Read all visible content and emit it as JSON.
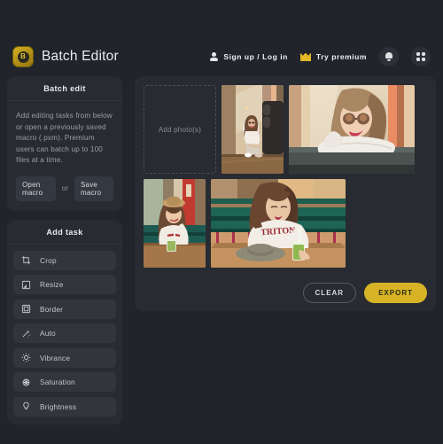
{
  "app": {
    "background": "#21242a",
    "accent": "#d6b426"
  },
  "header": {
    "logo_letter": "B",
    "title": "Batch Editor",
    "signup_label": "Sign up / Log in",
    "premium_label": "Try premium",
    "person_icon": "person-icon",
    "crown_icon": "crown-icon",
    "bell_icon": "bell-icon",
    "apps_icon": "grid-apps-icon"
  },
  "sidebar": {
    "batch_edit": {
      "title": "Batch edit",
      "description": "Add editing tasks from below or open a previously saved macro (.pxm). Premium users can batch up to 100 files at a time.",
      "open_macro_label": "Open macro",
      "or_label": "or",
      "save_macro_label": "Save macro"
    },
    "add_task": {
      "title": "Add task",
      "items": [
        {
          "label": "Crop",
          "icon": "crop-icon"
        },
        {
          "label": "Resize",
          "icon": "resize-icon"
        },
        {
          "label": "Border",
          "icon": "border-icon"
        },
        {
          "label": "Auto",
          "icon": "magic-wand-icon"
        },
        {
          "label": "Vibrance",
          "icon": "sun-icon"
        },
        {
          "label": "Saturation",
          "icon": "saturation-icon"
        },
        {
          "label": "Brightness",
          "icon": "lightbulb-icon"
        }
      ]
    }
  },
  "main": {
    "dropzone_label": "Add photo(s)",
    "photos": [
      {
        "name": "woman-sitting-on-floor",
        "orientation": "portrait"
      },
      {
        "name": "woman-leaning-on-couch",
        "orientation": "landscape"
      },
      {
        "name": "woman-with-hat-drinking",
        "orientation": "portrait"
      },
      {
        "name": "woman-in-diner-booth",
        "orientation": "landscape"
      }
    ],
    "clear_label": "CLEAR",
    "export_label": "EXPORT"
  }
}
